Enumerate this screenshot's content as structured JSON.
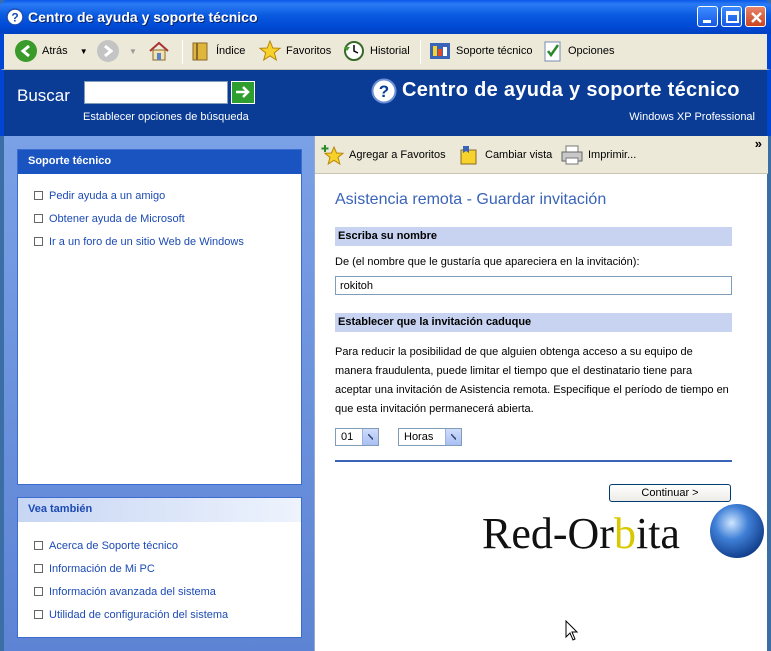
{
  "window": {
    "title": "Centro de ayuda y soporte técnico"
  },
  "toolbar": {
    "back_label": "Atrás",
    "index_label": "Índice",
    "favorites_label": "Favoritos",
    "history_label": "Historial",
    "support_label": "Soporte técnico",
    "options_label": "Opciones"
  },
  "header": {
    "search_label": "Buscar",
    "search_value": "",
    "search_options": "Establecer opciones de búsqueda",
    "title": "Centro de ayuda y soporte técnico",
    "edition": "Windows XP Professional"
  },
  "left": {
    "support": {
      "title": "Soporte técnico",
      "items": [
        "Pedir ayuda a un amigo",
        "Obtener ayuda de Microsoft",
        "Ir a un foro de un sitio Web de Windows"
      ]
    },
    "see_also": {
      "title": "Vea también",
      "items": [
        "Acerca de Soporte técnico",
        "Información de Mi PC",
        "Información avanzada del sistema",
        "Utilidad de configuración del sistema"
      ]
    }
  },
  "right_toolbar": {
    "add_favorites": "Agregar a Favoritos",
    "change_view": "Cambiar vista",
    "print": "Imprimir...",
    "more": "»"
  },
  "content": {
    "page_title": "Asistencia remota - Guardar invitación",
    "name_section": "Escriba su nombre",
    "name_label": "De (el nombre que le gustaría que apareciera en la invitación):",
    "name_value": "rokitoh",
    "expire_section": "Establecer que la invitación caduque",
    "expire_text": "Para reducir la posibilidad de que alguien obtenga acceso a su equipo de manera fraudulenta, puede limitar el tiempo que el destinatario tiene para aceptar una invitación de Asistencia remota. Especifique el período de tiempo en que esta invitación permanecerá abierta.",
    "duration_value": "01",
    "duration_unit": "Horas",
    "continue_label": "Continuar >"
  },
  "watermark": {
    "text_a": "Red-Or",
    "text_b": "b",
    "text_c": "ita"
  }
}
